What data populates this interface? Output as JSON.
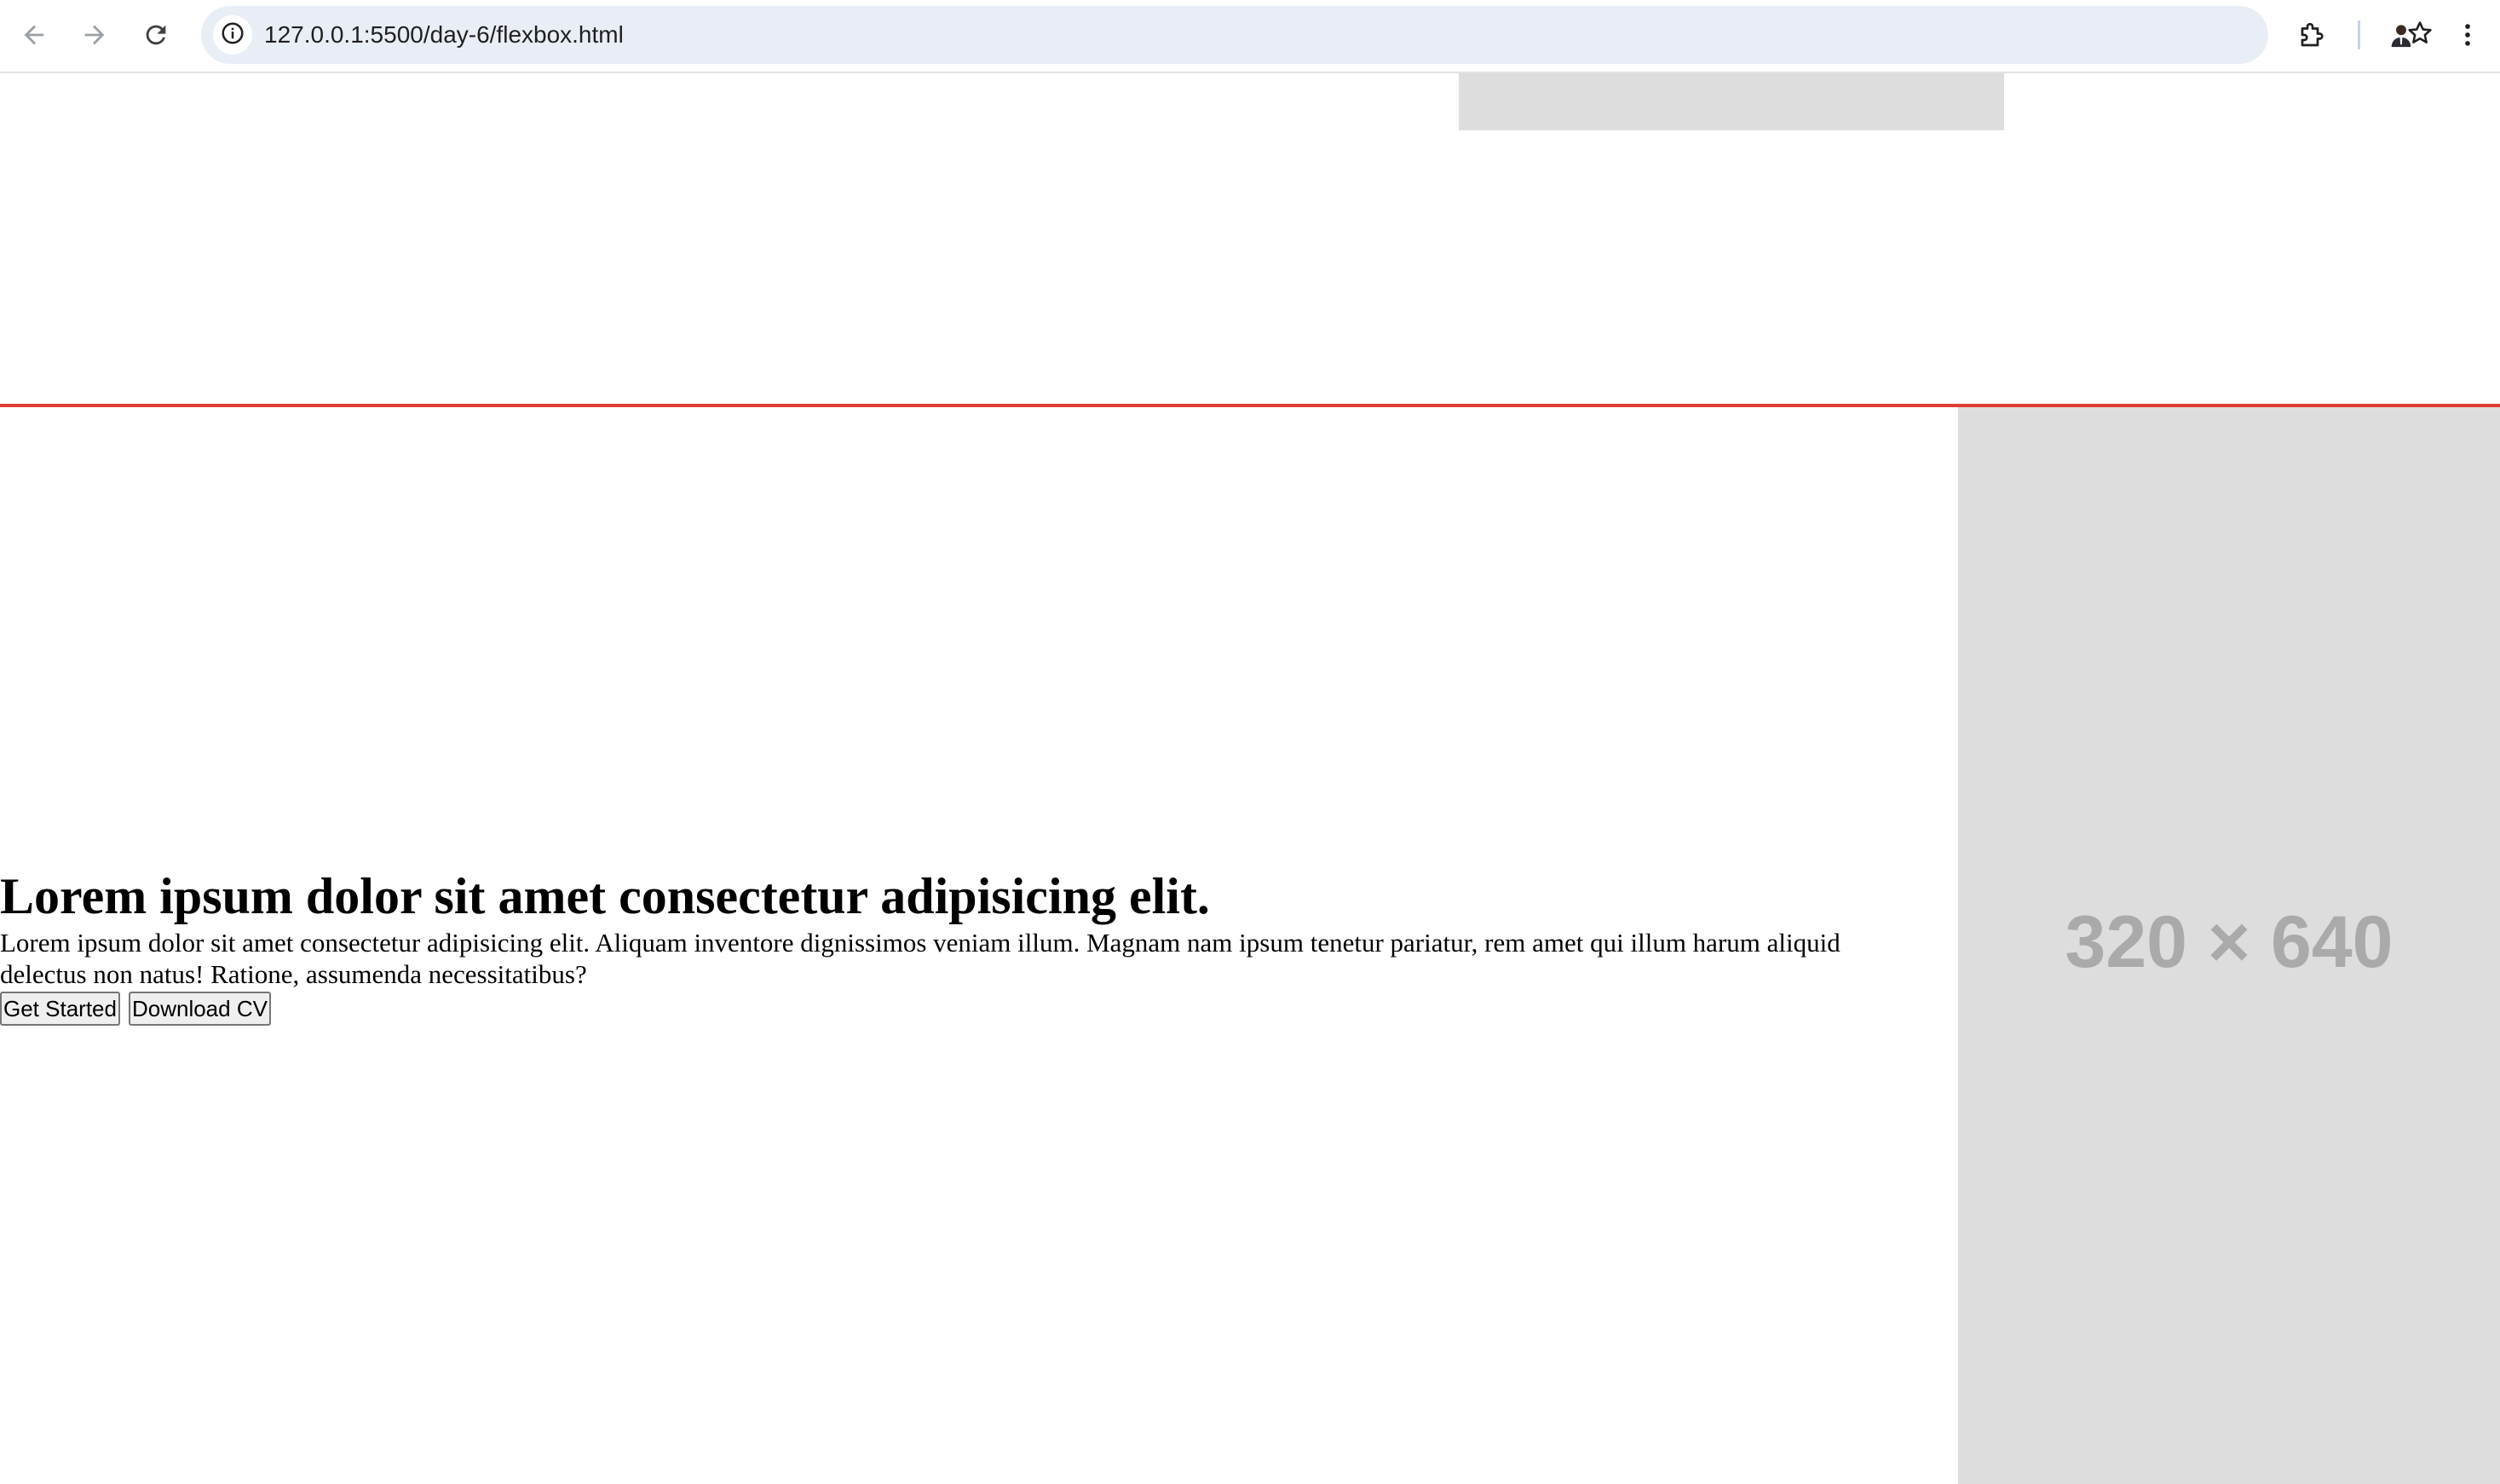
{
  "browser": {
    "url": "127.0.0.1:5500/day-6/flexbox.html",
    "icons": {
      "back": "arrow-left-icon",
      "forward": "arrow-right-icon",
      "reload": "reload-icon",
      "site_info": "info-icon",
      "bookmark": "star-icon",
      "extensions": "puzzle-icon",
      "profile": "avatar",
      "menu": "kebab-menu-icon"
    }
  },
  "hero": {
    "title": "Lorem ipsum dolor sit amet consectetur adipisicing elit.",
    "description": "Lorem ipsum dolor sit amet consectetur adipisicing elit. Aliquam inventore dignissimos veniam illum. Magnam nam ipsum tenetur pariatur, rem amet qui illum harum aliquid delectus non natus! Ratione, assumenda necessitatibus?",
    "buttons": {
      "primary": "Get Started",
      "secondary": "Download CV"
    }
  },
  "placeholder_image": {
    "label": "320 × 640"
  },
  "colors": {
    "divider": "#e23c33",
    "placeholder_bg": "#dddddd",
    "placeholder_text": "#aaaaaa",
    "omnibox_bg": "#e9edf5"
  }
}
